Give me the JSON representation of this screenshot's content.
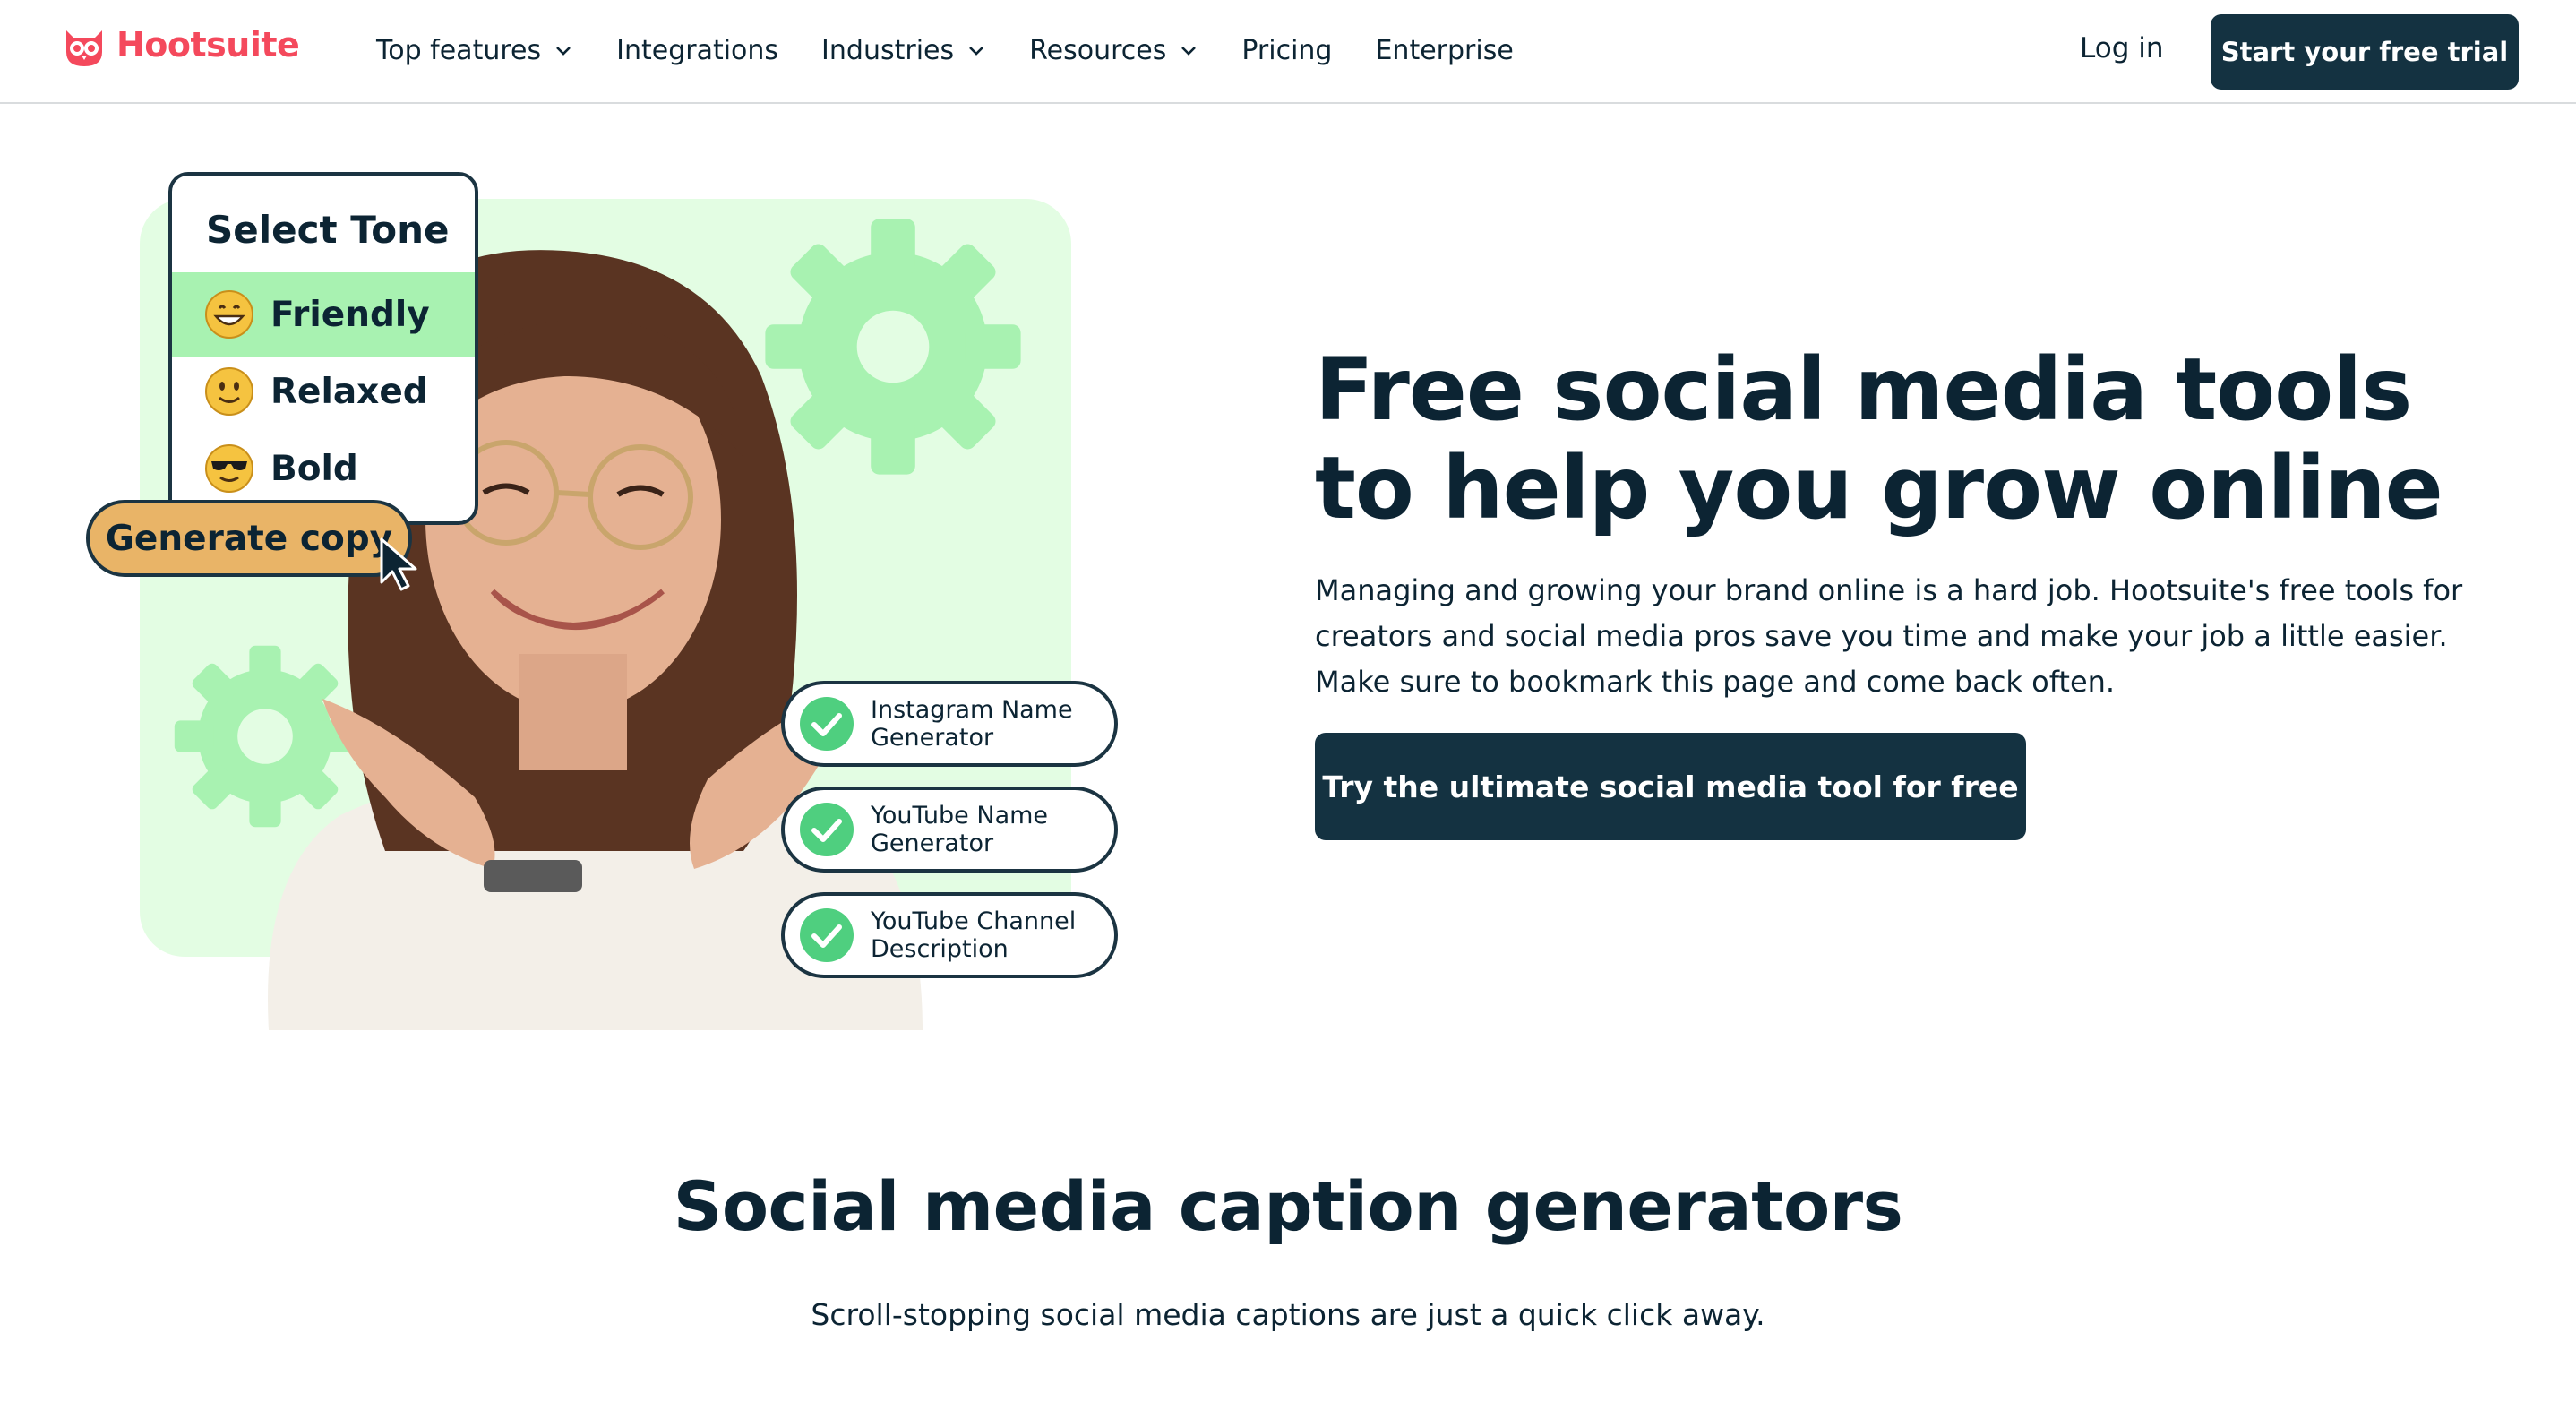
{
  "brand": {
    "name": "Hootsuite",
    "color": "#f4495c"
  },
  "nav": {
    "items": [
      {
        "label": "Top features",
        "has_dropdown": true
      },
      {
        "label": "Integrations",
        "has_dropdown": false
      },
      {
        "label": "Industries",
        "has_dropdown": true
      },
      {
        "label": "Resources",
        "has_dropdown": true
      },
      {
        "label": "Pricing",
        "has_dropdown": false
      },
      {
        "label": "Enterprise",
        "has_dropdown": false
      }
    ],
    "login_label": "Log in",
    "trial_label": "Start your free trial"
  },
  "illustration": {
    "tone_card": {
      "title": "Select Tone",
      "options": [
        {
          "label": "Friendly",
          "icon": "grinning-face-icon",
          "selected": true
        },
        {
          "label": "Relaxed",
          "icon": "slightly-smiling-face-icon",
          "selected": false
        },
        {
          "label": "Bold",
          "icon": "sunglasses-face-icon",
          "selected": false
        }
      ]
    },
    "generate_label": "Generate copy",
    "tools": [
      {
        "label": "Instagram Name Generator"
      },
      {
        "label": "YouTube Name Generator"
      },
      {
        "label": "YouTube Channel Description"
      }
    ]
  },
  "hero": {
    "title": "Free social media tools to help you grow online",
    "description": "Managing and growing your brand online is a hard job. Hootsuite's free tools for creators and social media pros save you time and make your job a little easier. Make sure to bookmark this page and come back often.",
    "cta_label": "Try the ultimate social media tool for free"
  },
  "section": {
    "title": "Social media caption generators",
    "subtitle": "Scroll-stopping social media captions are just a quick click away."
  },
  "colors": {
    "navy": "#143241",
    "text": "#0c2433",
    "mint": "#e3fde3",
    "green": "#a8f2b1",
    "check": "#4fcf7f",
    "gold": "#e9b467"
  }
}
